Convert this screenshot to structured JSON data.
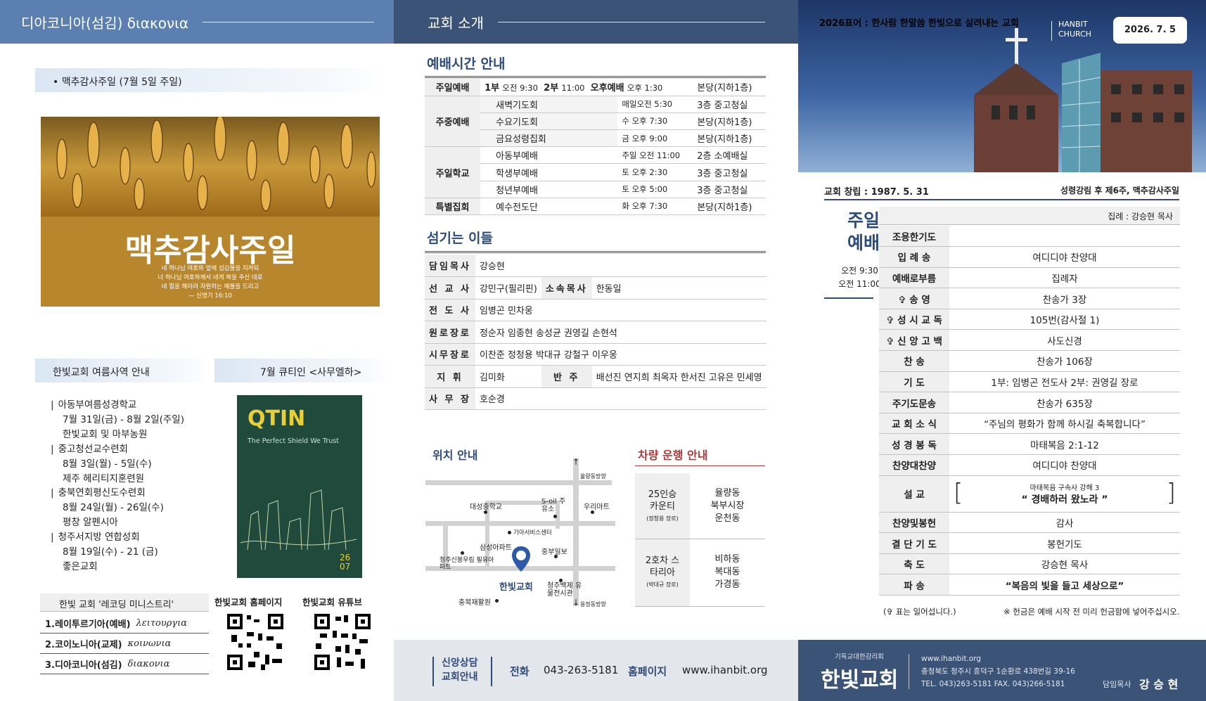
{
  "panel1": {
    "header_title": "디아코니아(섬김) διακονια",
    "event_bullet": "•  맥추감사주일 (7월 5일 주일)",
    "banner": {
      "title": "맥추감사주일",
      "verse_l1": "네 하나님 여호와 앞에 섬김물을 지켜되",
      "verse_l2": "너 하나님 여호와께서 네게 복을 주신 대로",
      "verse_l3": "네 힘을 헤아려 자원하는 예물을 드리고",
      "verse_ref": "— 신명기 16:10"
    },
    "summer_title": "한빛교회 여름사역 안내",
    "summer_items": [
      {
        "title": "아동부여름성경학교",
        "l1": "7월 31일(금) - 8월 2일(주일)",
        "l2": "한빛교회 및 마부농원"
      },
      {
        "title": "중고청선교수련회",
        "l1": "8월 3일(월) - 5일(수)",
        "l2": "제주 헤리티지훈련원"
      },
      {
        "title": "충북연회평신도수련회",
        "l1": "8월 24일(월) - 26일(수)",
        "l2": "평창 알펜시아"
      },
      {
        "title": "청주서지방 연합성회",
        "l1": "8월 19일(수) - 21 (금)",
        "l2": "좋은교회"
      }
    ],
    "qt_title": "7월 큐티인 <사무엘하>",
    "qt_cover": {
      "logo": "QTIN",
      "subtitle": "The Perfect Shield We Trust",
      "issue_l1": "26",
      "issue_l2": "07"
    },
    "records_title": "한빛 교회 '레코딩 미니스트리'",
    "records": [
      {
        "label": "1.레이투르기아(예배)",
        "greek": "λειτουργια"
      },
      {
        "label": "2.코이노니아(교제)",
        "greek": "κοινωνια"
      },
      {
        "label": "3.디아코니아(섬김)",
        "greek": "διακονια"
      }
    ],
    "qr_home": "한빛교회 홈페이지",
    "qr_youtube": "한빛교회 유튜브"
  },
  "panel2": {
    "header_title": "교회 소개",
    "worship_title": "예배시간 안내",
    "sunday": {
      "label": "주일예배",
      "s1": "1부",
      "t1": "오전 9:30",
      "s2": "2부",
      "t2": "11:00",
      "s3": "오후예배",
      "t3": "오후 1:30",
      "place": "본당(지하1층)"
    },
    "weekday_label": "주중예배",
    "weekday": [
      {
        "name": "새벽기도회",
        "time": "매일오전 5:30",
        "place": "3층 중고청실"
      },
      {
        "name": "수요기도회",
        "time": "수 오후 7:30",
        "place": "본당(지하1층)"
      },
      {
        "name": "금요성령집회",
        "time": "금 오후 9:00",
        "place": "본당(지하1층)"
      }
    ],
    "school_label": "주일학교",
    "school": [
      {
        "name": "아동부예배",
        "time": "주일 오전 11:00",
        "place": "2층 소예배실"
      },
      {
        "name": "학생부예배",
        "time": "토 오후 2:30",
        "place": "3층 중고청실"
      },
      {
        "name": "청년부예배",
        "time": "토 오후 5:00",
        "place": "3층 중고청실"
      }
    ],
    "special": {
      "label": "특별집회",
      "name": "예수전도단",
      "time": "화 오후 7:30",
      "place": "본당(지하1층)"
    },
    "staff_title": "섬기는 이들",
    "staff": {
      "pastor_label": "담임목사",
      "pastor": "강승현",
      "missionary_label": "선 교 사",
      "missionary": "강민구(필리핀)",
      "assoc_label": "소속목사",
      "assoc": "한동일",
      "evangelist_label": "전 도 사",
      "evangelist": "임병곤 민차웅",
      "elder_label": "원로장로",
      "elder": "정순자 임종현 송성균 권영길 손현석",
      "active_label": "시무장로",
      "active": "이찬준 정청용 박대규 강철구 이우웅",
      "conductor_label": "지 휘",
      "conductor": "김미화",
      "accomp_label": "반 주",
      "accomp": "배선진 연지희 최옥자 한서진 고유은 민세영",
      "office_label": "사 무 장",
      "office": "호순경"
    },
    "location_title": "위치 안내",
    "map": {
      "n_label": "율량동방향",
      "s_label": "용정동방향",
      "school": "대성중학교",
      "soil": "S-oil 주유소",
      "woori": "우리마트",
      "service": "기아서비스센터",
      "samsung": "삼성아파트",
      "jungbu": "중부일보",
      "apt": "청주신봉우림 필유아파트",
      "church": "한빛교회",
      "heritage": "청주백제 유물전시관",
      "hospital": "충북재활원"
    },
    "bus_title": "차량 운행 안내",
    "bus": [
      {
        "name": "25인승 카운티",
        "driver": "(정청용 장로)",
        "route_l1": "율량동",
        "route_l2": "북부시장",
        "route_l3": "운천동"
      },
      {
        "name": "2호차 스타리아",
        "driver": "(박대규 장로)",
        "route_l1": "비하동",
        "route_l2": "복대동",
        "route_l3": "가경동"
      }
    ],
    "footer": {
      "counsel_l1": "신앙상담",
      "counsel_l2": "교회안내",
      "phone_label": "전화",
      "phone": "043-263-5181",
      "home_label": "홈페이지",
      "home": "www.ihanbit.org"
    }
  },
  "panel3": {
    "slogan": "2026표어 : 한사람 한말씀 한빛으로 살려내는 교회",
    "brand_l1": "HANBIT",
    "brand_l2": "CHURCH",
    "date": "2026. 7. 5",
    "founded": "교회 창립 : 1987. 5. 31",
    "season": "성령강림 후 제6주, 맥추감사주일",
    "service_title_l1": "주일",
    "service_title_l2": "예배",
    "service_time_l1": "오전 9:30",
    "service_time_l2": "오전 11:00",
    "presider": "집례 : 강승현 목사",
    "order": [
      {
        "label": "조용한기도",
        "value": ""
      },
      {
        "label": "입 례 송",
        "value": "여디디야 찬양대"
      },
      {
        "label": "예배로부름",
        "value": "집례자"
      },
      {
        "label": "✞ 송 영",
        "value": "찬송가 3장"
      },
      {
        "label": "✞ 성 시 교 독",
        "value": "105번(감사절 1)"
      },
      {
        "label": "✞ 신 앙 고 백",
        "value": "사도신경"
      },
      {
        "label": "찬 송",
        "value": "찬송가 106장"
      },
      {
        "label": "기 도",
        "value": "1부: 임병곤 전도사 2부: 권영길 장로"
      },
      {
        "label": "주기도문송",
        "value": "찬송가 635장"
      },
      {
        "label": "교 회 소 식",
        "value": "“주님의 평화가 함께 하시길 축복합니다”"
      },
      {
        "label": "성 경 봉 독",
        "value": "마태복음 2:1-12"
      },
      {
        "label": "찬양대찬양",
        "value": "여디디야 찬양대"
      }
    ],
    "sermon": {
      "label": "설 교",
      "ref": "마태복음 구속사 강해 3",
      "title": "“ 경배하러 왔노라 ”"
    },
    "order2": [
      {
        "label": "찬양및봉헌",
        "value": "감사"
      },
      {
        "label": "결 단 기 도",
        "value": "봉헌기도"
      },
      {
        "label": "축 도",
        "value": "강승현 목사"
      },
      {
        "label": "파 송",
        "value": "“복음의 빛을 들고 세상으로”"
      }
    ],
    "note_stand": "(✞ 표는 일어섭니다.)",
    "note_offering": "※ 헌금은 예배 시작 전 미리 헌금함에 넣어주십시오.",
    "footer": {
      "denom": "기독교대한감리회",
      "name": "한빛교회",
      "web": "www.ihanbit.org",
      "addr": "충청북도 청주시 흥덕구 1순환로 438번길 39-16",
      "tel": "TEL. 043)263-5181    FAX. 043)266-5181",
      "pastor_label": "담임목사",
      "pastor": "강 승 현"
    }
  }
}
